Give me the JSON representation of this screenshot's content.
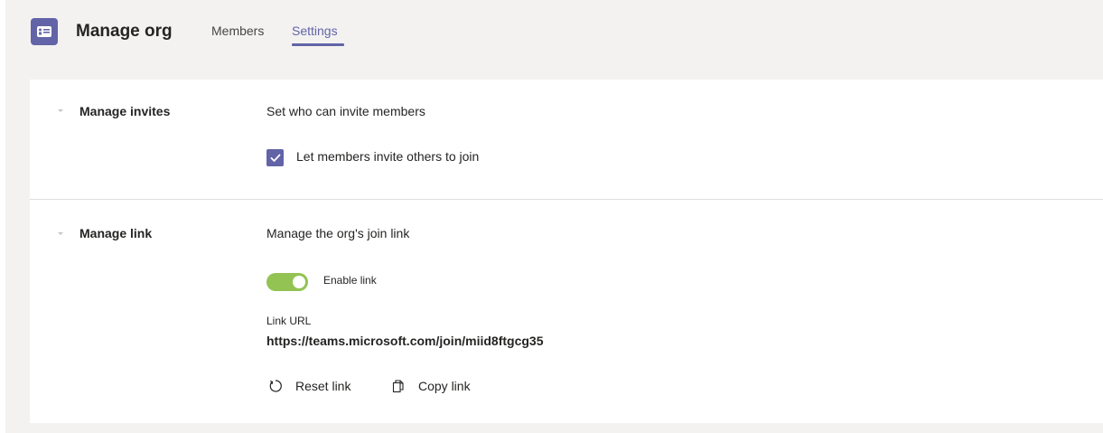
{
  "header": {
    "title": "Manage org",
    "tabs": [
      {
        "label": "Members"
      },
      {
        "label": "Settings",
        "active": true
      }
    ]
  },
  "sections": {
    "invites": {
      "title": "Manage invites",
      "description": "Set who can invite members",
      "checkbox_label": "Let members invite others to join",
      "checkbox_checked": true
    },
    "link": {
      "title": "Manage link",
      "description": "Manage the org's join link",
      "toggle_label": "Enable link",
      "toggle_on": true,
      "url_caption": "Link URL",
      "url": "https://teams.microsoft.com/join/miid8ftgcg35",
      "reset_label": "Reset link",
      "copy_label": "Copy link"
    }
  },
  "icons": {
    "app": "teams-org-icon",
    "reset": "reset-icon",
    "copy": "copy-icon",
    "checkbox": "checkmark-icon",
    "collapse": "chevron-down-icon"
  },
  "colors": {
    "accent": "#6264a7",
    "toggle_on": "#92c353",
    "background": "#f3f2f1",
    "card": "#ffffff"
  }
}
